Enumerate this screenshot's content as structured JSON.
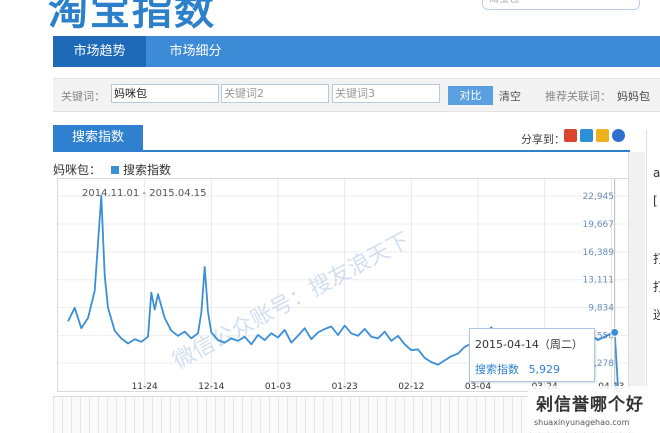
{
  "header": {
    "logo": "淘宝指数",
    "search_placeholder": "淘宝包"
  },
  "nav": {
    "tabs": [
      {
        "label": "市场趋势"
      },
      {
        "label": "市场细分"
      }
    ]
  },
  "keywords": {
    "label": "关键词：",
    "input1": "妈咪包",
    "input2_placeholder": "关键词2",
    "input3_placeholder": "关键词3",
    "compare": "对比",
    "clear": "清空",
    "recommend_label": "推荐关联词：",
    "recommend_item": "妈妈包"
  },
  "section": {
    "title": "搜索指数",
    "share_label": "分享到："
  },
  "legend": {
    "keyword": "妈咪包：",
    "series": "搜索指数"
  },
  "colors": {
    "accent": "#3d8bd6",
    "line": "#3a8fd6"
  },
  "tooltip": {
    "date": "2015-04-14（周二）",
    "label": "搜索指数",
    "value": "5,929"
  },
  "watermark": {
    "text": "微信公众账号：搜友浪天下",
    "brand": "剁信誉哪个好",
    "url": "shuaxinyunagehao.com"
  },
  "right_edge": {
    "chars": [
      "（",
      "a",
      "[",
      "（",
      "打",
      "打",
      "迷"
    ]
  },
  "chart_data": {
    "type": "line",
    "date_range": "2014.11.01 - 2015.04.15",
    "x_ticks": [
      "11-24",
      "12-14",
      "01-03",
      "01-23",
      "02-12",
      "03-04",
      "03-24",
      "04-13"
    ],
    "y_ticks": [
      22945,
      19667,
      16389,
      13111,
      9834,
      6556,
      3278
    ],
    "ylim": [
      0,
      24500
    ],
    "series": [
      {
        "name": "搜索指数",
        "x": [
          "2014-11-01",
          "2014-11-03",
          "2014-11-05",
          "2014-11-07",
          "2014-11-09",
          "2014-11-11",
          "2014-11-12",
          "2014-11-13",
          "2014-11-15",
          "2014-11-17",
          "2014-11-19",
          "2014-11-21",
          "2014-11-23",
          "2014-11-25",
          "2014-11-26",
          "2014-11-27",
          "2014-11-28",
          "2014-11-30",
          "2014-12-02",
          "2014-12-04",
          "2014-12-06",
          "2014-12-08",
          "2014-12-10",
          "2014-12-11",
          "2014-12-12",
          "2014-12-13",
          "2014-12-14",
          "2014-12-16",
          "2014-12-18",
          "2014-12-20",
          "2014-12-22",
          "2014-12-24",
          "2014-12-26",
          "2014-12-28",
          "2014-12-30",
          "2015-01-01",
          "2015-01-03",
          "2015-01-05",
          "2015-01-07",
          "2015-01-09",
          "2015-01-11",
          "2015-01-13",
          "2015-01-15",
          "2015-01-17",
          "2015-01-19",
          "2015-01-21",
          "2015-01-23",
          "2015-01-25",
          "2015-01-27",
          "2015-01-29",
          "2015-01-31",
          "2015-02-02",
          "2015-02-04",
          "2015-02-06",
          "2015-02-08",
          "2015-02-10",
          "2015-02-12",
          "2015-02-14",
          "2015-02-16",
          "2015-02-18",
          "2015-02-20",
          "2015-02-22",
          "2015-02-24",
          "2015-02-26",
          "2015-02-28",
          "2015-03-02",
          "2015-03-04",
          "2015-03-06",
          "2015-03-08",
          "2015-03-10",
          "2015-03-12",
          "2015-03-14",
          "2015-03-16",
          "2015-03-18",
          "2015-03-20",
          "2015-03-22",
          "2015-03-24",
          "2015-03-26",
          "2015-03-28",
          "2015-03-30",
          "2015-04-01",
          "2015-04-03",
          "2015-04-05",
          "2015-04-07",
          "2015-04-09",
          "2015-04-11",
          "2015-04-13",
          "2015-04-14",
          "2015-04-15"
        ],
        "values": [
          8200,
          9800,
          7400,
          8600,
          11800,
          23000,
          13600,
          9800,
          7100,
          6200,
          5600,
          6100,
          5800,
          6400,
          11600,
          9600,
          11400,
          8600,
          7100,
          6500,
          7000,
          6200,
          6800,
          9200,
          14600,
          9300,
          6900,
          6000,
          5700,
          6200,
          5900,
          6400,
          5500,
          6600,
          6000,
          6800,
          6300,
          7200,
          5700,
          6500,
          7400,
          6100,
          6900,
          7300,
          7600,
          6600,
          7700,
          6800,
          6500,
          7300,
          6400,
          6200,
          7000,
          5900,
          6500,
          5500,
          4800,
          4900,
          3900,
          3400,
          3100,
          3600,
          4100,
          4400,
          5200,
          5600,
          6800,
          6500,
          7500,
          5900,
          6200,
          5700,
          6900,
          5900,
          6400,
          6100,
          5500,
          6800,
          6200,
          5600,
          6600,
          7100,
          6200,
          6600,
          6000,
          6400,
          6800,
          6900,
          400
        ]
      }
    ]
  }
}
